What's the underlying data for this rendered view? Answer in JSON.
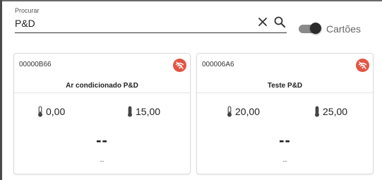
{
  "search": {
    "label": "Procurar",
    "value": "P&D"
  },
  "view_toggle": {
    "label": "Cartões",
    "checked": true
  },
  "cards": [
    {
      "id": "00000B66",
      "name": "Ar condicionado P&D",
      "status_icon": "wifi-off-icon",
      "temp_min": "0,00",
      "temp_max": "15,00",
      "value": "--",
      "subvalue": "--"
    },
    {
      "id": "000006A6",
      "name": "Teste P&D",
      "status_icon": "wifi-off-icon",
      "temp_min": "20,00",
      "temp_max": "25,00",
      "value": "--",
      "subvalue": "--"
    }
  ],
  "colors": {
    "offline": "#e25544",
    "text": "#212121",
    "toggle_knob": "#2b2b2b"
  }
}
